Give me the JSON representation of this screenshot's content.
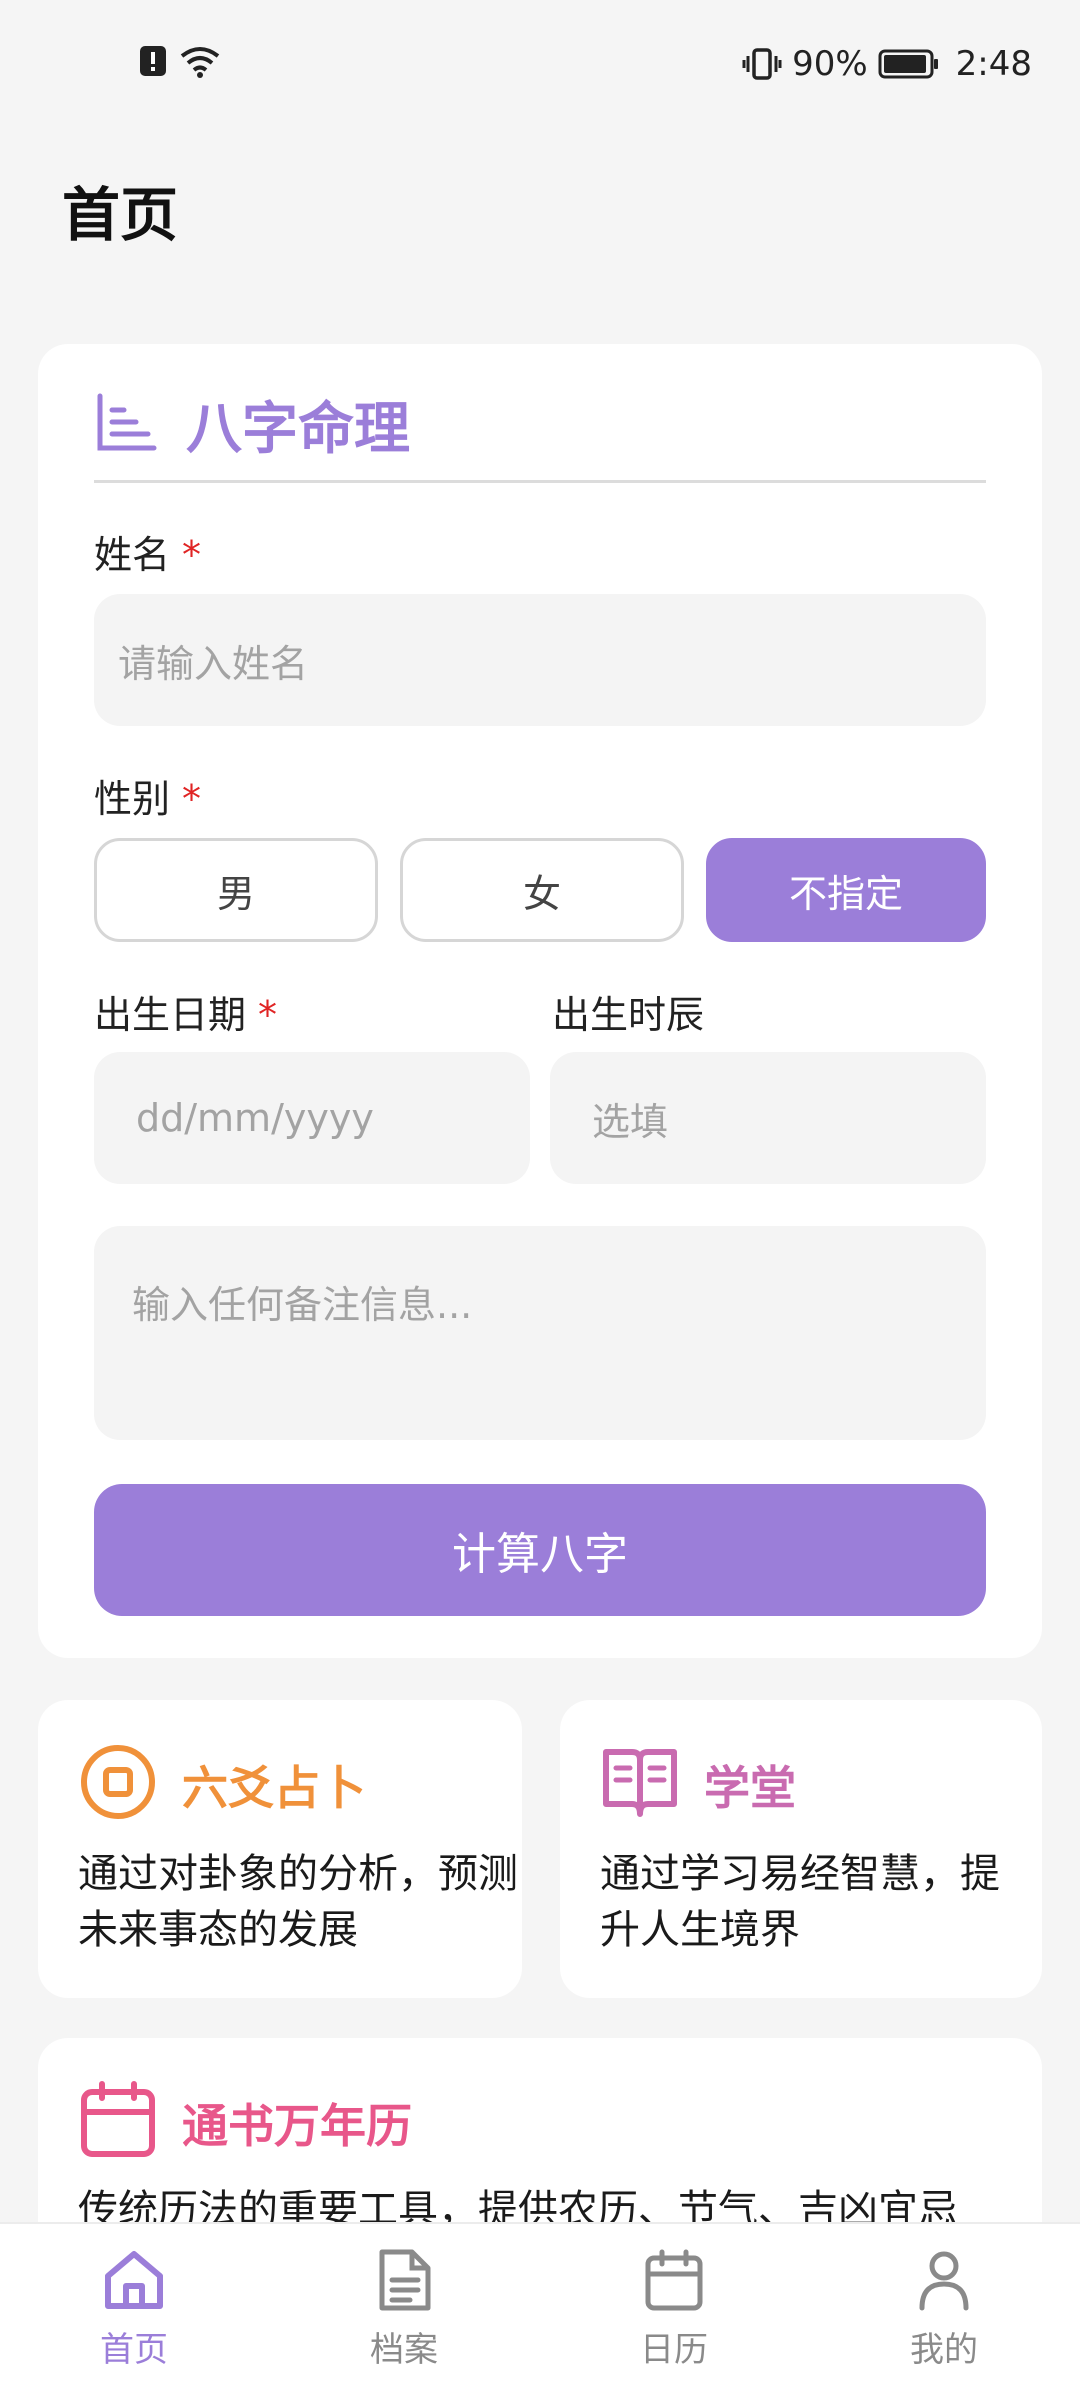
{
  "status_bar": {
    "battery": "90%",
    "time": "2:48",
    "icons": [
      "alert-icon",
      "wifi-icon",
      "vibrate-icon",
      "battery-icon"
    ]
  },
  "header": {
    "title": "首页"
  },
  "bazi": {
    "title": "八字命理",
    "name_label": "姓名",
    "required_mark": "*",
    "name_placeholder": "请输入姓名",
    "gender_label": "性别",
    "gender_options": [
      "男",
      "女",
      "不指定"
    ],
    "gender_selected": "不指定",
    "birth_date_label": "出生日期",
    "birth_date_placeholder": "dd/mm/yyyy",
    "birth_hour_label": "出生时辰",
    "birth_hour_placeholder": "选填",
    "notes_placeholder": "输入任何备注信息...",
    "submit_label": "计算八字"
  },
  "features": [
    {
      "title": "六爻占卜",
      "desc": "通过对卦象的分析，预测未来事态的发展",
      "color": "#f0913a",
      "icon": "coin-icon"
    },
    {
      "title": "学堂",
      "desc": "通过学习易经智慧，提升人生境界",
      "color": "#c96bb0",
      "icon": "book-icon"
    },
    {
      "title": "通书万年历",
      "desc": "传统历法的重要工具，提供农历、节气、吉凶宜忌",
      "color": "#e8578a",
      "icon": "calendar-icon"
    }
  ],
  "bottom_nav": [
    {
      "label": "首页",
      "icon": "home-icon",
      "active": true
    },
    {
      "label": "档案",
      "icon": "document-icon",
      "active": false
    },
    {
      "label": "日历",
      "icon": "calendar-icon",
      "active": false
    },
    {
      "label": "我的",
      "icon": "profile-icon",
      "active": false
    }
  ],
  "colors": {
    "accent": "#9b7ed9",
    "required": "#e02424",
    "background": "#f5f5f5"
  }
}
